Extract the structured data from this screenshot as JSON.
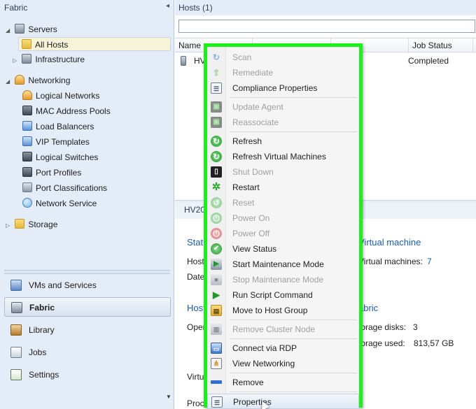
{
  "left_pane": {
    "header": "Fabric",
    "collapse_glyph": "◂",
    "tree": [
      {
        "label": "Servers",
        "icon": "servers-icon",
        "expander": "◢"
      },
      {
        "label": "All Hosts",
        "icon": "folder-icon"
      },
      {
        "label": "Infrastructure",
        "icon": "infrastructure-icon",
        "expander": "▷"
      },
      {
        "label": "Networking",
        "icon": "networking-icon",
        "expander": "◢"
      },
      {
        "label": "Logical Networks",
        "icon": "logical-networks-icon"
      },
      {
        "label": "MAC Address Pools",
        "icon": "mac-pool-icon"
      },
      {
        "label": "Load Balancers",
        "icon": "load-balancer-icon"
      },
      {
        "label": "VIP Templates",
        "icon": "vip-template-icon"
      },
      {
        "label": "Logical Switches",
        "icon": "logical-switch-icon"
      },
      {
        "label": "Port Profiles",
        "icon": "port-profile-icon"
      },
      {
        "label": "Port Classifications",
        "icon": "port-classification-icon"
      },
      {
        "label": "Network Service",
        "icon": "network-service-icon"
      },
      {
        "label": "Storage",
        "icon": "storage-icon",
        "expander": "▷"
      }
    ],
    "workspaces": [
      {
        "label": "VMs and Services",
        "icon": "vms-services-icon"
      },
      {
        "label": "Fabric",
        "icon": "fabric-icon"
      },
      {
        "label": "Library",
        "icon": "library-icon"
      },
      {
        "label": "Jobs",
        "icon": "jobs-icon"
      },
      {
        "label": "Settings",
        "icon": "settings-icon"
      }
    ],
    "scroll_glyph": "▼"
  },
  "right_pane": {
    "header": "Hosts (1)",
    "search_value": "",
    "columns": [
      "Name",
      "",
      "",
      "Job Status"
    ],
    "row": {
      "name": "HV",
      "job_status": "Completed"
    },
    "detail_header": "HV20",
    "detail": {
      "status_heading": "Stat",
      "host_label": "Host",
      "date_label": "Date",
      "hosts_heading": "Host",
      "oper_label": "Oper",
      "virt_label": "Virtu",
      "proc_label": "Proc",
      "vm_heading": "Virtual machine",
      "vm_label": "Virtual machines:",
      "vm_count": "7",
      "fabric_heading": "abric",
      "storage_disks_label": "torage disks:",
      "storage_disks_value": "3",
      "storage_used_label": "torage used:",
      "storage_used_value": "813,57 GB"
    }
  },
  "context_menu": {
    "highlight_color": "#1bf01b",
    "items": [
      {
        "label": "Scan",
        "icon": "scan-icon",
        "enabled": false
      },
      {
        "label": "Remediate",
        "icon": "remediate-icon",
        "enabled": false
      },
      {
        "label": "Compliance Properties",
        "icon": "compliance-properties-icon",
        "enabled": true
      },
      {
        "label": "Update Agent",
        "icon": "update-agent-icon",
        "enabled": false
      },
      {
        "label": "Reassociate",
        "icon": "reassociate-icon",
        "enabled": false
      },
      {
        "label": "Refresh",
        "icon": "refresh-icon",
        "enabled": true
      },
      {
        "label": "Refresh Virtual Machines",
        "icon": "refresh-vms-icon",
        "enabled": true
      },
      {
        "label": "Shut Down",
        "icon": "shut-down-icon",
        "enabled": false
      },
      {
        "label": "Restart",
        "icon": "restart-icon",
        "enabled": true
      },
      {
        "label": "Reset",
        "icon": "reset-icon",
        "enabled": false
      },
      {
        "label": "Power On",
        "icon": "power-on-icon",
        "enabled": false
      },
      {
        "label": "Power Off",
        "icon": "power-off-icon",
        "enabled": false
      },
      {
        "label": "View Status",
        "icon": "view-status-icon",
        "enabled": true
      },
      {
        "label": "Start Maintenance Mode",
        "icon": "start-maintenance-icon",
        "enabled": true
      },
      {
        "label": "Stop Maintenance Mode",
        "icon": "stop-maintenance-icon",
        "enabled": false
      },
      {
        "label": "Run Script Command",
        "icon": "run-script-icon",
        "enabled": true
      },
      {
        "label": "Move to Host Group",
        "icon": "move-host-group-icon",
        "enabled": true
      },
      {
        "label": "Remove Cluster Node",
        "icon": "remove-cluster-node-icon",
        "enabled": false
      },
      {
        "label": "Connect via RDP",
        "icon": "rdp-icon",
        "enabled": true
      },
      {
        "label": "View Networking",
        "icon": "view-networking-icon",
        "enabled": true
      },
      {
        "label": "Remove",
        "icon": "remove-icon",
        "enabled": true
      },
      {
        "label": "Properties",
        "icon": "properties-icon",
        "enabled": true
      }
    ]
  }
}
